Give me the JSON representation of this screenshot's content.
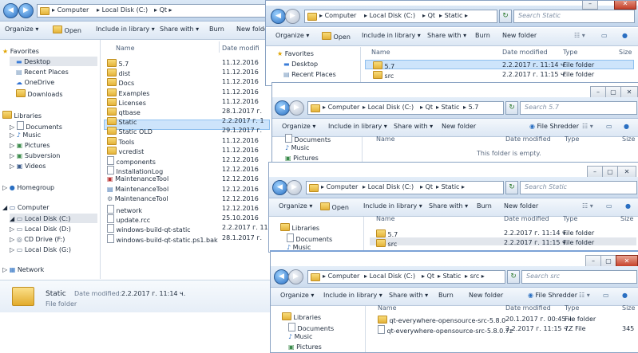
{
  "w1": {
    "crumbs": [
      "Computer",
      "Local Disk (C:)",
      "Qt"
    ],
    "toolbar": {
      "organize": "Organize ▾",
      "open": "Open",
      "include": "Include in library ▾",
      "share": "Share with ▾",
      "burn": "Burn",
      "newfolder": "New folder"
    },
    "headers": {
      "name": "Name",
      "date": "Date modifi"
    },
    "nav": {
      "favorites": "Favorites",
      "desktop": "Desktop",
      "recent": "Recent Places",
      "onedrive": "OneDrive",
      "downloads": "Downloads",
      "libraries": "Libraries",
      "documents": "Documents",
      "music": "Music",
      "pictures": "Pictures",
      "subversion": "Subversion",
      "videos": "Videos",
      "homegroup": "Homegroup",
      "computer": "Computer",
      "c": "Local Disk (C:)",
      "d": "Local Disk (D:)",
      "f": "CD Drive (F:)",
      "g": "Local Disk (G:)",
      "network": "Network"
    },
    "rows": [
      {
        "name": "5.7",
        "date": "11.12.2016",
        "type": "folder"
      },
      {
        "name": "dist",
        "date": "11.12.2016",
        "type": "folder"
      },
      {
        "name": "Docs",
        "date": "11.12.2016",
        "type": "folder"
      },
      {
        "name": "Examples",
        "date": "11.12.2016",
        "type": "folder"
      },
      {
        "name": "Licenses",
        "date": "11.12.2016",
        "type": "folder"
      },
      {
        "name": "qtbase",
        "date": "28.1.2017 г.",
        "type": "folder"
      },
      {
        "name": "Static",
        "date": "2.2.2017 г. 1",
        "type": "folder"
      },
      {
        "name": "Static OLD",
        "date": "29.1.2017 г.",
        "type": "folder"
      },
      {
        "name": "Tools",
        "date": "11.12.2016",
        "type": "folder"
      },
      {
        "name": "vcredist",
        "date": "11.12.2016",
        "type": "folder"
      },
      {
        "name": "components",
        "date": "12.12.2016",
        "type": "file"
      },
      {
        "name": "InstallationLog",
        "date": "12.12.2016",
        "type": "file"
      },
      {
        "name": "MaintenanceTool",
        "date": "12.12.2016",
        "type": "exe"
      },
      {
        "name": "MaintenanceTool",
        "date": "12.12.2016",
        "type": "dat"
      },
      {
        "name": "MaintenanceTool",
        "date": "12.12.2016",
        "type": "ini"
      },
      {
        "name": "network",
        "date": "12.12.2016",
        "type": "file"
      },
      {
        "name": "update.rcc",
        "date": "25.10.2016",
        "type": "file"
      },
      {
        "name": "windows-build-qt-static",
        "date": "2.2.2017 г. 11",
        "type": "file"
      },
      {
        "name": "windows-build-qt-static.ps1.bak",
        "date": "28.1.2017 г.",
        "type": "file"
      }
    ],
    "details": {
      "name": "Static",
      "label": "Date modified:",
      "date": "2.2.2017 г. 11:14 ч.",
      "kind": "File folder"
    }
  },
  "w2": {
    "crumbs": [
      "Computer",
      "Local Disk (C:)",
      "Qt",
      "Static"
    ],
    "search": "Search Static",
    "toolbar": {
      "organize": "Organize ▾",
      "open": "Open",
      "include": "Include in library ▾",
      "share": "Share with ▾",
      "burn": "Burn",
      "newfolder": "New folder"
    },
    "headers": {
      "name": "Name",
      "date": "Date modified",
      "type": "Type",
      "size": "Size"
    },
    "nav": {
      "favorites": "Favorites",
      "desktop": "Desktop",
      "recent": "Recent Places"
    },
    "rows": [
      {
        "name": "5.7",
        "date": "2.2.2017 г. 11:14 ч.",
        "type": "File folder"
      },
      {
        "name": "src",
        "date": "2.2.2017 г. 11:15 ч.",
        "type": "File folder"
      }
    ]
  },
  "w3": {
    "crumbs": [
      "Computer",
      "Local Disk (C:)",
      "Qt",
      "Static",
      "5.7"
    ],
    "search": "Search 5.7",
    "toolbar": {
      "organize": "Organize ▾",
      "include": "Include in library ▾",
      "share": "Share with ▾",
      "newfolder": "New folder",
      "shredder": "File Shredder"
    },
    "headers": {
      "name": "Name",
      "date": "Date modified",
      "type": "Type",
      "size": "Size"
    },
    "nav": {
      "documents": "Documents",
      "music": "Music",
      "pictures": "Pictures"
    },
    "empty": "This folder is empty."
  },
  "w4": {
    "crumbs": [
      "Computer",
      "Local Disk (C:)",
      "Qt",
      "Static"
    ],
    "search": "Search Static",
    "toolbar": {
      "organize": "Organize ▾",
      "open": "Open",
      "include": "Include in library ▾",
      "share": "Share with ▾",
      "burn": "Burn",
      "newfolder": "New folder"
    },
    "headers": {
      "name": "Name",
      "date": "Date modified",
      "type": "Type",
      "size": "Size"
    },
    "nav": {
      "libraries": "Libraries",
      "documents": "Documents",
      "music": "Music"
    },
    "rows": [
      {
        "name": "5.7",
        "date": "2.2.2017 г. 11:14 ч.",
        "type": "File folder"
      },
      {
        "name": "src",
        "date": "2.2.2017 г. 11:15 ч.",
        "type": "File folder"
      }
    ]
  },
  "w5": {
    "crumbs": [
      "Computer",
      "Local Disk (C:)",
      "Qt",
      "Static",
      "src"
    ],
    "search": "Search src",
    "toolbar": {
      "organize": "Organize ▾",
      "include": "Include in library ▾",
      "share": "Share with ▾",
      "burn": "Burn",
      "newfolder": "New folder",
      "shredder": "File Shredder"
    },
    "headers": {
      "name": "Name",
      "date": "Date modified",
      "type": "Type",
      "size": "Size"
    },
    "nav": {
      "libraries": "Libraries",
      "documents": "Documents",
      "music": "Music",
      "pictures": "Pictures"
    },
    "rows": [
      {
        "name": "qt-everywhere-opensource-src-5.8.0",
        "date": "20.1.2017 г. 00:45 ч.",
        "type": "File folder",
        "size": ""
      },
      {
        "name": "qt-everywhere-opensource-src-5.8.0.7z",
        "date": "2.2.2017 г. 11:15 ч.",
        "type": "7Z File",
        "size": "345"
      }
    ]
  },
  "controls": {
    "min": "–",
    "max": "▢",
    "close": "✕"
  },
  "colors": {
    "accent": "#2a6fc2",
    "selection": "#cde4fb",
    "folder": "#e4b33a"
  }
}
